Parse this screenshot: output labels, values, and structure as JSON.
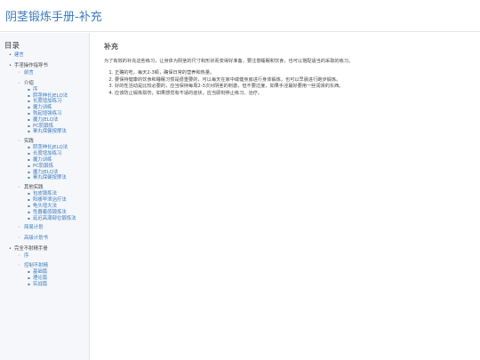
{
  "header": {
    "title": "阴茎锻炼手册-补充"
  },
  "sidebar": {
    "toc_title": "目录",
    "items": [
      {
        "label": "建言",
        "link": true
      },
      {
        "label": "手淫操作指导书",
        "link": false,
        "children": [
          {
            "label": "前言",
            "link": true
          },
          {
            "label": "介绍",
            "link": false,
            "children": [
              {
                "label": "序",
                "link": true
              },
              {
                "label": "阴茎伸长JELQ法",
                "link": true
              },
              {
                "label": "长度增加练习",
                "link": true
              },
              {
                "label": "握力训练",
                "link": true
              },
              {
                "label": "勃起增强练习",
                "link": true
              },
              {
                "label": "握力JELQ法",
                "link": true
              },
              {
                "label": "PC肌锻炼",
                "link": true
              },
              {
                "label": "睾丸保健按摩法",
                "link": true
              }
            ]
          },
          {
            "label": "实践",
            "link": false,
            "children": [
              {
                "label": "阴茎伸长JELQ法",
                "link": true
              },
              {
                "label": "长度增加练习",
                "link": true
              },
              {
                "label": "握力训练",
                "link": true
              },
              {
                "label": "PC肌锻炼",
                "link": true
              },
              {
                "label": "握力JELQ法",
                "link": true
              },
              {
                "label": "睾丸保健按摩法",
                "link": true
              }
            ]
          },
          {
            "label": "其他实践",
            "link": false,
            "children": [
              {
                "label": "包皮锻炼法",
                "link": true
              },
              {
                "label": "阳痿早泄治疗法",
                "link": true
              },
              {
                "label": "龟头增大法",
                "link": true
              },
              {
                "label": "性器着感锻炼法",
                "link": true
              },
              {
                "label": "延迟高潮部位锻炼法",
                "link": true
              }
            ]
          },
          {
            "label": "简易计划",
            "link": true
          },
          {
            "label": "高级计划书",
            "link": true
          }
        ]
      },
      {
        "label": "完全不射精手册",
        "link": false,
        "children": [
          {
            "label": "序",
            "link": true
          },
          {
            "label": "控制不射精",
            "link": true,
            "children": [
              {
                "label": "基础篇",
                "link": true
              },
              {
                "label": "理论篇",
                "link": true
              },
              {
                "label": "实战篇",
                "link": true
              }
            ]
          }
        ]
      }
    ]
  },
  "content": {
    "section_title": "补充",
    "intro": "为了有效的补充这些练习，让身体为阴茎的尺寸和形状而变得好准备，要注意睡眠和饮食，也可以搭配适当的采取的练习。",
    "points": [
      "正确的吃，每天2-3顿，确保日常的营养和热量。",
      "要保持健康的饮食和睡眠习惯是很重要的，可以每天在家中或健身房进行身体锻炼，也可以早晨进行跑步锻炼。",
      "好的性活动是比较必要的，应当保持每周2-3次对阴茎的刺激，但不要过度，如果手淫最好要用一些润滑的东西。",
      "应该防止锻炼损伤，如果感觉有不适的症状，应当即刻停止练习、治疗。"
    ]
  }
}
